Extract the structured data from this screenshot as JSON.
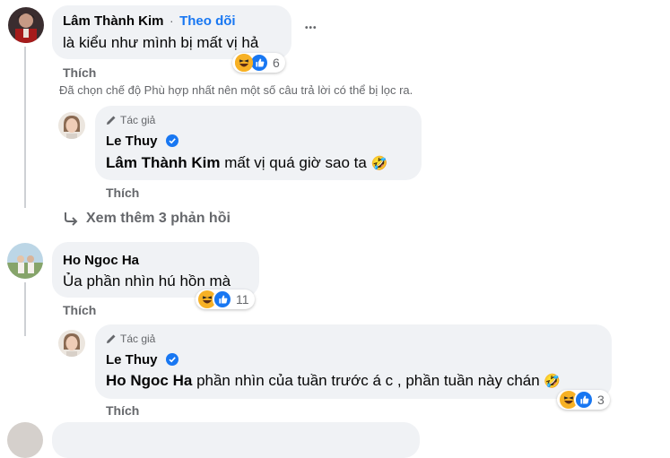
{
  "comment1": {
    "author": "Lâm Thành Kim",
    "separator": "·",
    "follow_label": "Theo dõi",
    "text": "là kiểu như mình bị mất vị hả",
    "reaction_count": "6",
    "like_label": "Thích",
    "more_label": "•••"
  },
  "filter_notice": "Đã chọn chế độ Phù hợp nhất nên một số câu trả lời có thể bị lọc ra.",
  "reply1": {
    "author_tag": "Tác giả",
    "author": "Le Thuy",
    "mention": "Lâm Thành Kim",
    "text": " mất vị quá giờ sao ta ",
    "emoji": "🤣",
    "like_label": "Thích"
  },
  "see_more": {
    "icon": "reply-arrow-icon",
    "label": "Xem thêm 3 phản hồi"
  },
  "comment2": {
    "author": "Ho Ngoc Ha",
    "text": "Ủa phần nhìn hú hồn mà",
    "reaction_count": "11",
    "like_label": "Thích"
  },
  "reply2": {
    "author_tag": "Tác giả",
    "author": "Le Thuy",
    "mention": "Ho Ngoc Ha",
    "text": " phần nhìn của tuần trước á c , phần tuần này chán ",
    "emoji": "🤣",
    "reaction_count": "3",
    "like_label": "Thích"
  },
  "colors": {
    "bubble": "#f0f2f5",
    "link_blue": "#1877f2",
    "muted": "#65676b",
    "haha_yellow": "#f7b125"
  }
}
